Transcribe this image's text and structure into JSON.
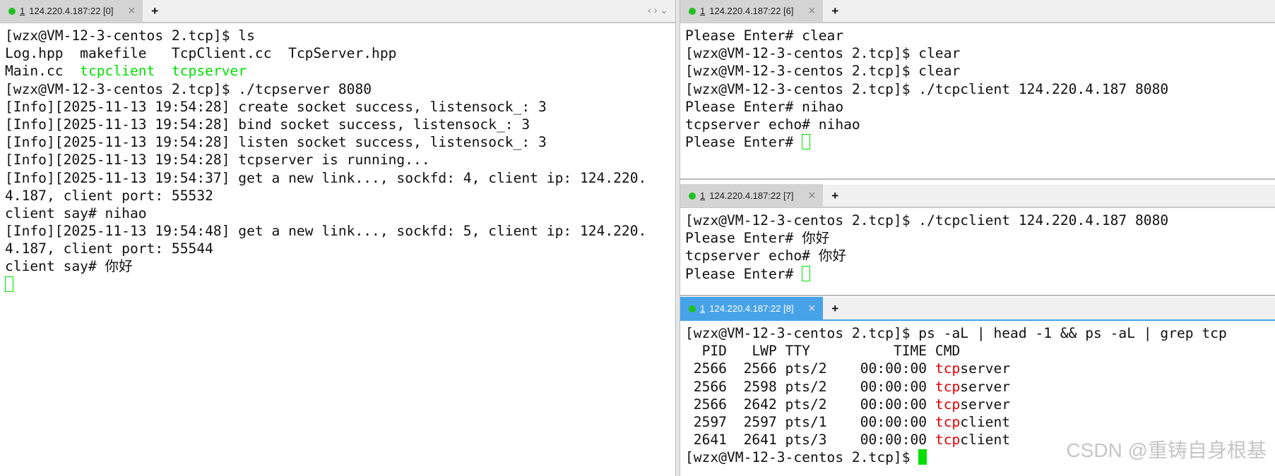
{
  "left": {
    "tab": {
      "num": "1",
      "title": "124.220.4.187:22 [0]"
    },
    "lines": [
      "[wzx@VM-12-3-centos 2.tcp]$ ls",
      "Log.hpp  makefile   TcpClient.cc  TcpServer.hpp",
      "Main.cc  ",
      "[wzx@VM-12-3-centos 2.tcp]$ ./tcpserver 8080",
      "[Info][2025-11-13 19:54:28] create socket success, listensock_: 3",
      "[Info][2025-11-13 19:54:28] bind socket success, listensock_: 3",
      "[Info][2025-11-13 19:54:28] listen socket success, listensock_: 3",
      "[Info][2025-11-13 19:54:28] tcpserver is running...",
      "[Info][2025-11-13 19:54:37] get a new link..., sockfd: 4, client ip: 124.220.",
      "4.187, client port: 55532",
      "client say# nihao",
      "[Info][2025-11-13 19:54:48] get a new link..., sockfd: 5, client ip: 124.220.",
      "4.187, client port: 55544",
      "client say# 你好"
    ],
    "exec1": "tcpclient",
    "exec2": "tcpserver"
  },
  "top": {
    "tab": {
      "num": "1",
      "title": "124.220.4.187:22 [6]"
    },
    "lines": [
      "Please Enter# clear",
      "[wzx@VM-12-3-centos 2.tcp]$ clear",
      "[wzx@VM-12-3-centos 2.tcp]$ clear",
      "[wzx@VM-12-3-centos 2.tcp]$ ./tcpclient 124.220.4.187 8080",
      "Please Enter# nihao",
      "tcpserver echo# nihao",
      "Please Enter# "
    ]
  },
  "mid": {
    "tab": {
      "num": "1",
      "title": "124.220.4.187:22 [7]"
    },
    "lines": [
      "[wzx@VM-12-3-centos 2.tcp]$ ./tcpclient 124.220.4.187 8080",
      "Please Enter# 你好",
      "tcpserver echo# 你好",
      "Please Enter# "
    ]
  },
  "bot": {
    "tab": {
      "num": "1",
      "title": "124.220.4.187:22 [8]"
    },
    "cmd": "[wzx@VM-12-3-centos 2.tcp]$ ps -aL | head -1 && ps -aL | grep tcp",
    "header": "  PID   LWP TTY          TIME CMD",
    "rows": [
      {
        "pre": " 2566  2566 pts/2    00:00:00 ",
        "hl": "tcp",
        "rest": "server"
      },
      {
        "pre": " 2566  2598 pts/2    00:00:00 ",
        "hl": "tcp",
        "rest": "server"
      },
      {
        "pre": " 2566  2642 pts/2    00:00:00 ",
        "hl": "tcp",
        "rest": "server"
      },
      {
        "pre": " 2597  2597 pts/1    00:00:00 ",
        "hl": "tcp",
        "rest": "client"
      },
      {
        "pre": " 2641  2641 pts/3    00:00:00 ",
        "hl": "tcp",
        "rest": "client"
      }
    ],
    "prompt": "[wzx@VM-12-3-centos 2.tcp]$ "
  },
  "watermark": "CSDN @重铸自身根基"
}
